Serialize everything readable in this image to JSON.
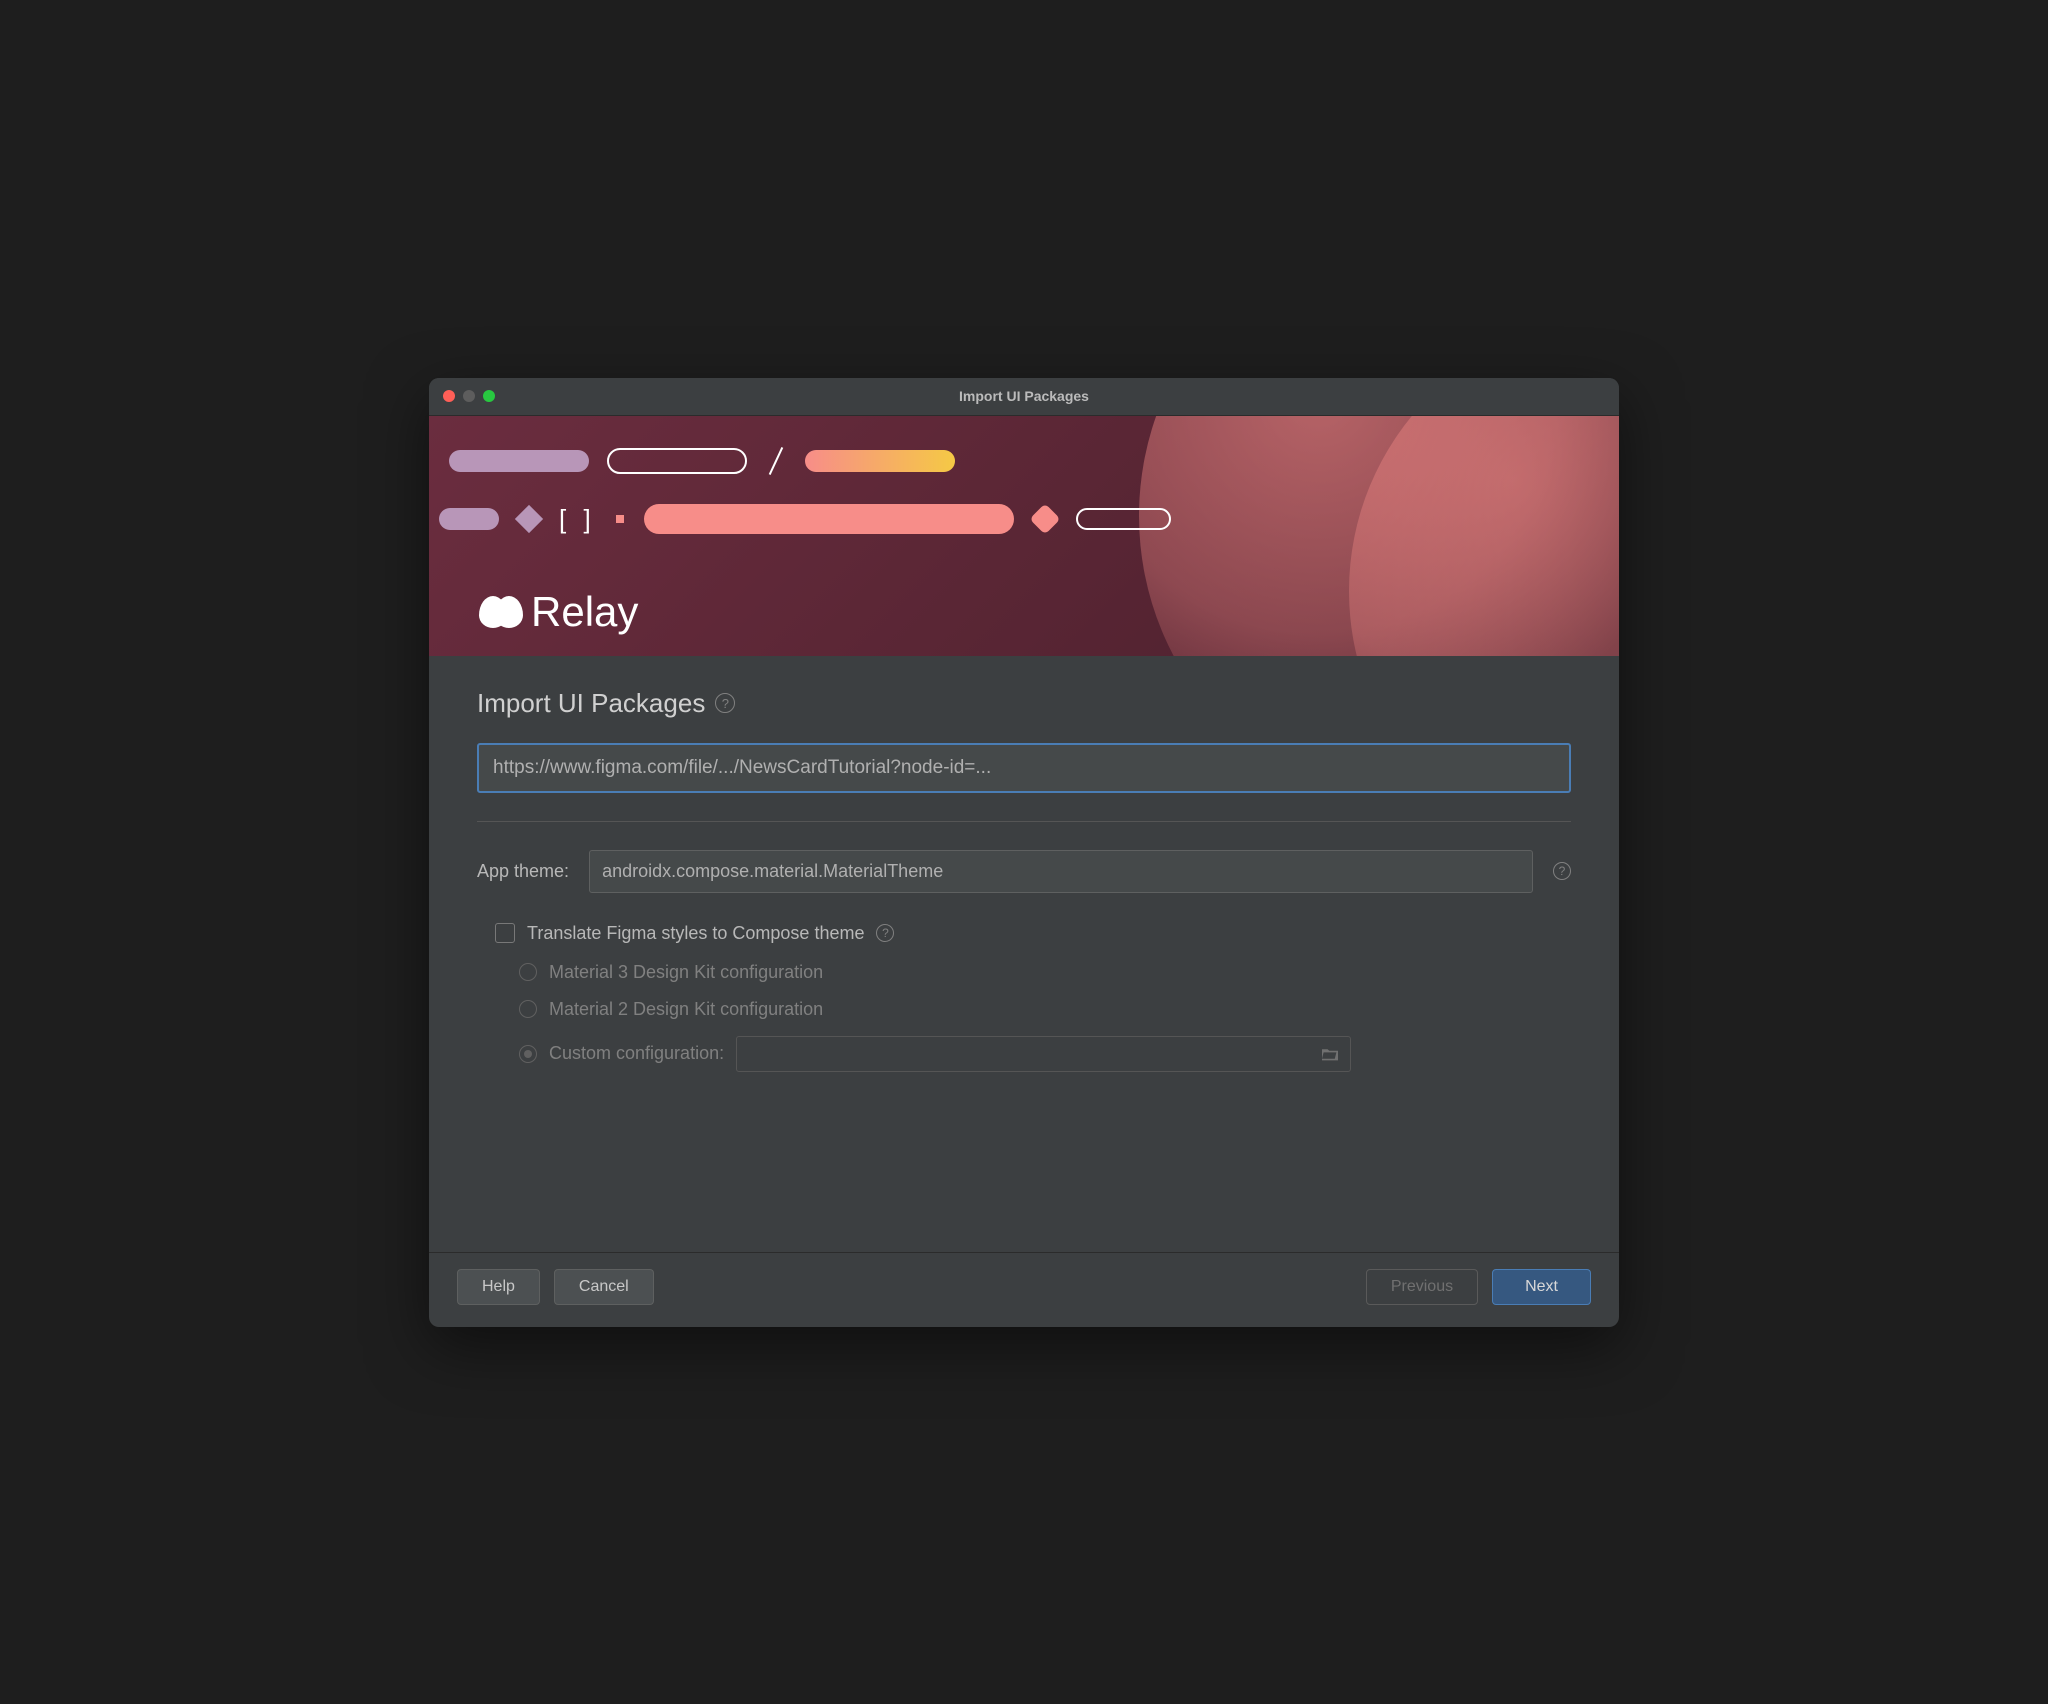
{
  "titlebar": {
    "title": "Import UI Packages"
  },
  "banner": {
    "brand": "Relay"
  },
  "content": {
    "heading": "Import UI Packages",
    "url_value": "https://www.figma.com/file/.../NewsCardTutorial?node-id=...",
    "theme": {
      "label": "App theme:",
      "value": "androidx.compose.material.MaterialTheme"
    },
    "translate": {
      "label": "Translate Figma styles to Compose theme",
      "checked": false
    },
    "config_options": {
      "material3": "Material 3 Design Kit configuration",
      "material2": "Material 2 Design Kit configuration",
      "custom": "Custom configuration:",
      "selected": "custom",
      "custom_value": ""
    }
  },
  "footer": {
    "help": "Help",
    "cancel": "Cancel",
    "previous": "Previous",
    "next": "Next"
  }
}
